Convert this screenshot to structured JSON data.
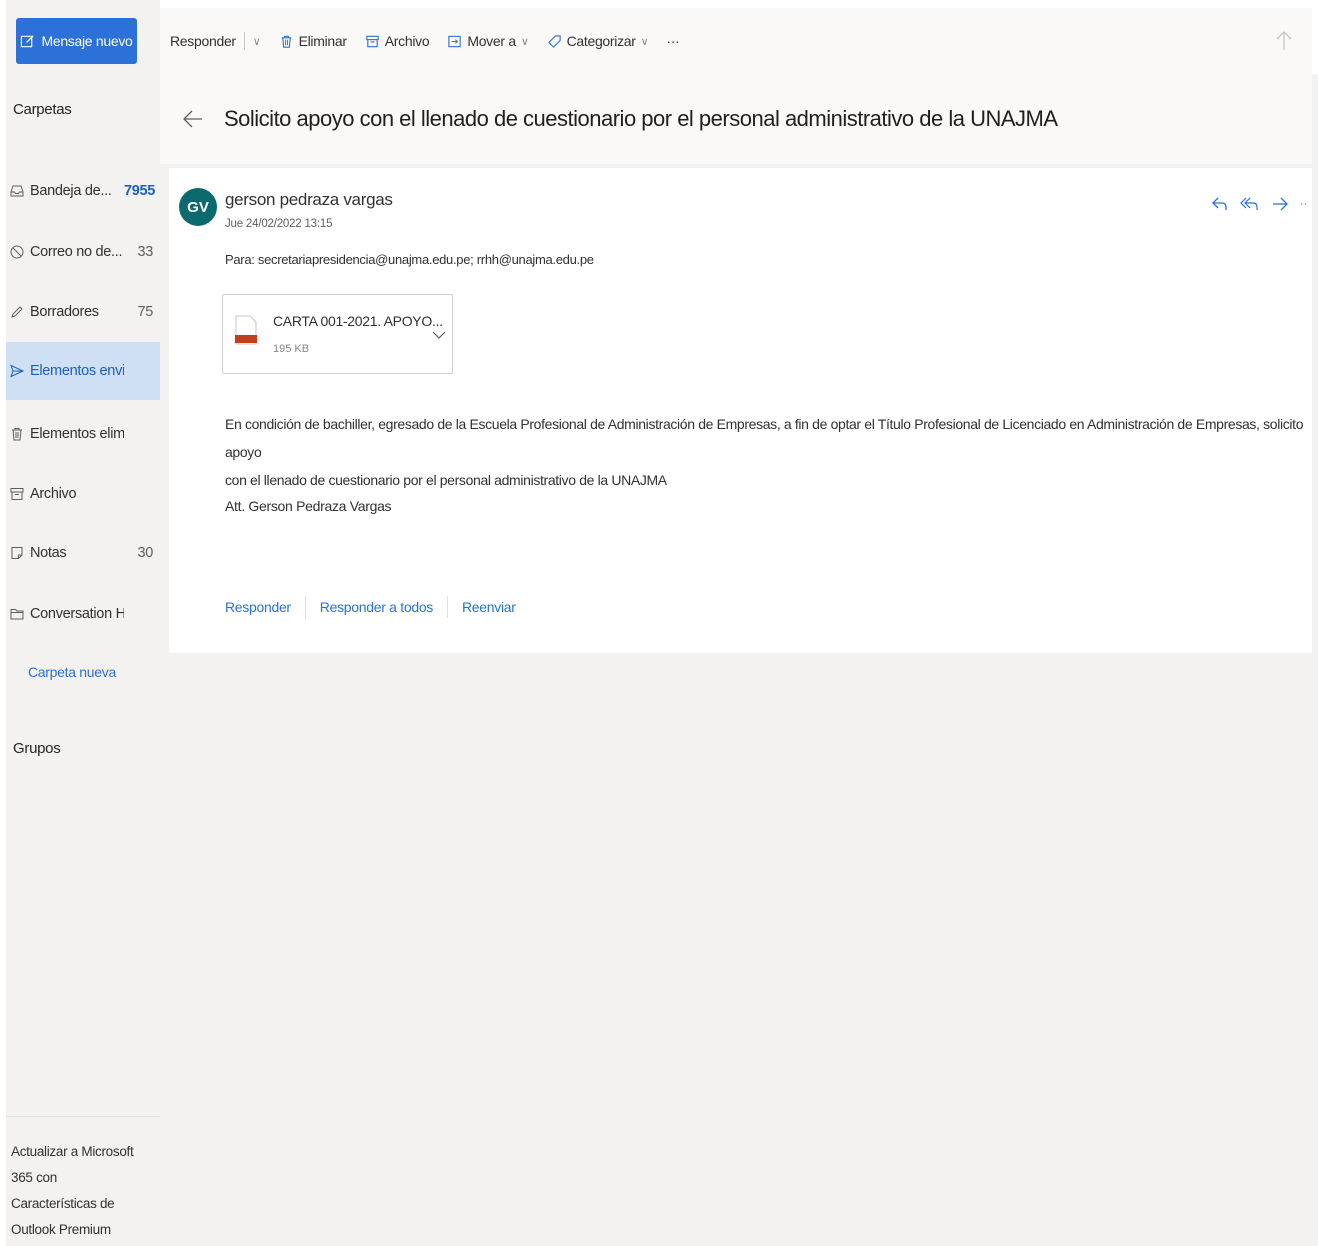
{
  "colors": {
    "accent": "#2b71d8",
    "avatar_bg": "#0b6a6e",
    "active_folder_bg": "#cfe0f5"
  },
  "sidebar": {
    "new_message_label": "Mensaje nuevo",
    "folders_heading": "Carpetas",
    "folders": [
      {
        "label": "Bandeja de...",
        "count": "7955",
        "icon": "inbox-icon"
      },
      {
        "label": "Correo no de...",
        "count": "33",
        "icon": "junk-icon"
      },
      {
        "label": "Borradores",
        "count": "75",
        "icon": "pencil-icon"
      },
      {
        "label": "Elementos envia...",
        "count": "",
        "icon": "send-icon"
      },
      {
        "label": "Elementos elimin...",
        "count": "",
        "icon": "trash-icon"
      },
      {
        "label": "Archivo",
        "count": "",
        "icon": "archive-icon"
      },
      {
        "label": "Notas",
        "count": "30",
        "icon": "note-icon"
      },
      {
        "label": "Conversation His...",
        "count": "",
        "icon": "folder-icon"
      }
    ],
    "new_folder_label": "Carpeta nueva",
    "groups_heading": "Grupos",
    "upgrade_text": [
      "Actualizar a Microsoft",
      "365 con",
      "Características de",
      "Outlook Premium"
    ]
  },
  "toolbar": {
    "reply": "Responder",
    "delete": "Eliminar",
    "archive": "Archivo",
    "move_to": "Mover a",
    "categorize": "Categorizar",
    "more": "···"
  },
  "message": {
    "subject": "Solicito apoyo con el llenado de cuestionario por el personal administrativo de la UNAJMA",
    "avatar_initials": "GV",
    "sender": "gerson pedraza vargas",
    "date": "Jue 24/02/2022 13:15",
    "to_line": "Para:  secretariapresidencia@unajma.edu.pe; rrhh@unajma.edu.pe",
    "attachment": {
      "name": "CARTA 001-2021. APOYO...",
      "size": "195 KB",
      "type_label": "pdf"
    },
    "body_line1": "En condición de bachiller, egresado de la Escuela Profesional de Administración de Empresas, a fin de optar el Título Profesional de Licenciado en Administración de Empresas, solicito  apoyo",
    "body_line2": "con el llenado de cuestionario por el personal administrativo de la UNAJMA",
    "signature": "Att. Gerson Pedraza Vargas",
    "reply_label": "Responder",
    "reply_all_label": "Responder a todos",
    "forward_label": "Reenviar"
  }
}
